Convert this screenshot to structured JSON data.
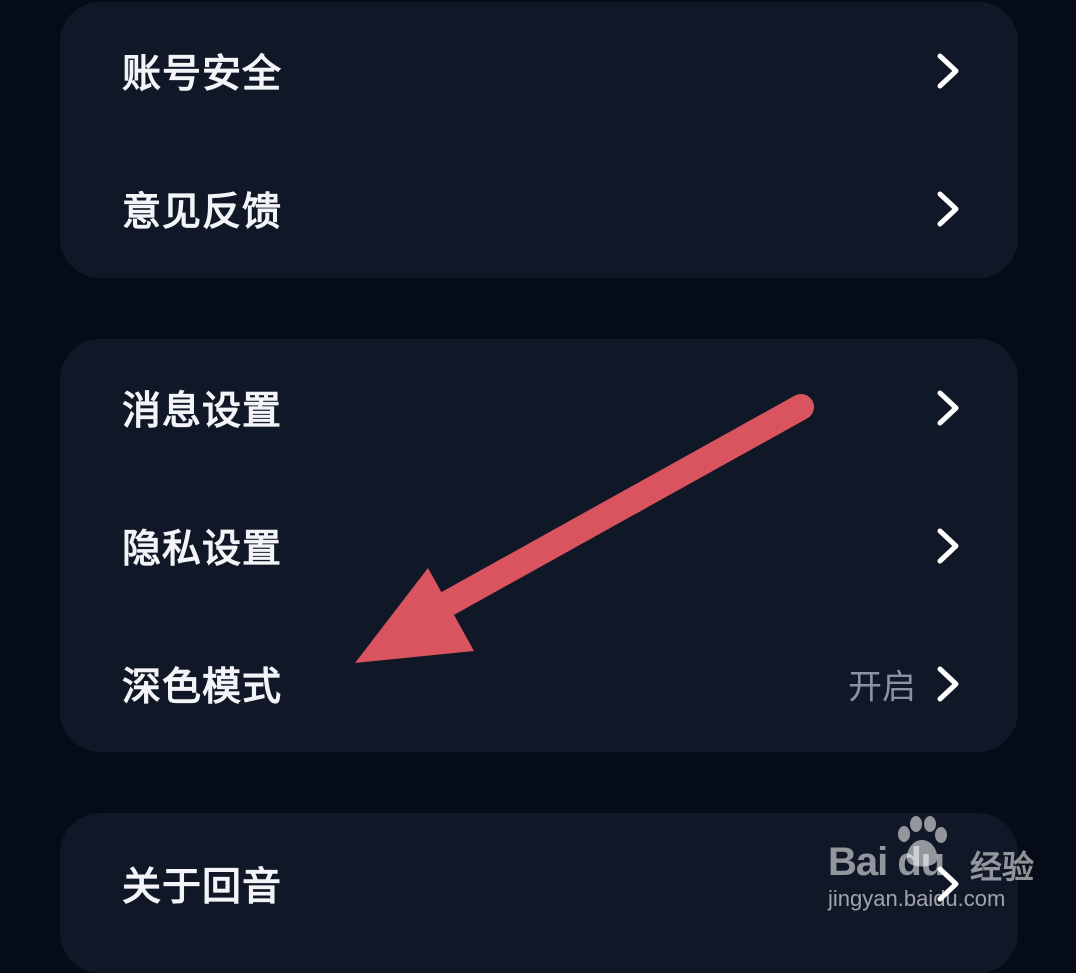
{
  "groups": [
    {
      "items": [
        {
          "label": "账号安全"
        },
        {
          "label": "意见反馈"
        }
      ]
    },
    {
      "items": [
        {
          "label": "消息设置"
        },
        {
          "label": "隐私设置"
        },
        {
          "label": "深色模式",
          "value": "开启"
        }
      ]
    },
    {
      "items": [
        {
          "label": "关于回音"
        }
      ]
    }
  ],
  "annotation": {
    "color": "#d9545e"
  },
  "watermark": {
    "brand": "Bai  du",
    "product": "经验",
    "url": "jingyan.baidu.com"
  },
  "colors": {
    "background": "#050b17",
    "card": "#101827",
    "label": "#f2f4f8",
    "value": "#8a93a3"
  }
}
